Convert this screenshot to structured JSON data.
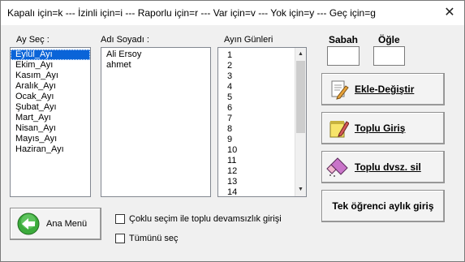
{
  "window": {
    "title": "Kapalı için=k --- İzinli için=i --- Raporlu için=r --- Var için=v --- Yok için=y --- Geç için=g",
    "close_label": "✕"
  },
  "month_panel": {
    "label": "Ay Seç :",
    "items": [
      "Eylül_Ayı",
      "Ekim_Ayı",
      "Kasım_Ayı",
      "Aralık_Ayı",
      "Ocak_Ayı",
      "Şubat_Ayı",
      "Mart_Ayı",
      "Nisan_Ayı",
      "Mayıs_Ayı",
      "Haziran_Ayı"
    ],
    "selected": "Eylül_Ayı"
  },
  "name_panel": {
    "label": "Adı Soyadı :",
    "items": [
      "Ali Ersoy",
      "ahmet"
    ]
  },
  "days_panel": {
    "label": "Ayın Günleri",
    "items": [
      "1",
      "2",
      "3",
      "4",
      "5",
      "6",
      "7",
      "8",
      "9",
      "10",
      "11",
      "12",
      "13",
      "14"
    ],
    "scroll_up": "▲",
    "scroll_down": "▼"
  },
  "inputs": {
    "sabah_label": "Sabah",
    "sabah_value": "",
    "ogle_label": "Öğle",
    "ogle_value": ""
  },
  "buttons": {
    "edit": "Ekle-Değiştir",
    "bulk_entry": "Toplu Giriş",
    "bulk_delete": "Toplu dvsz. sil",
    "monthly_entry": "Tek öğrenci aylık giriş",
    "main_menu": "Ana Menü"
  },
  "checkboxes": {
    "multi_select": {
      "label": "Çoklu seçim ile toplu devamsızlık girişi",
      "checked": false
    },
    "select_all": {
      "label": "Tümünü seç",
      "checked": false
    }
  },
  "icons": {
    "edit": "pencil-paper-icon",
    "bulk_entry": "notepad-pencil-icon",
    "bulk_delete": "eraser-icon",
    "main_menu": "green-back-arrow-icon"
  }
}
